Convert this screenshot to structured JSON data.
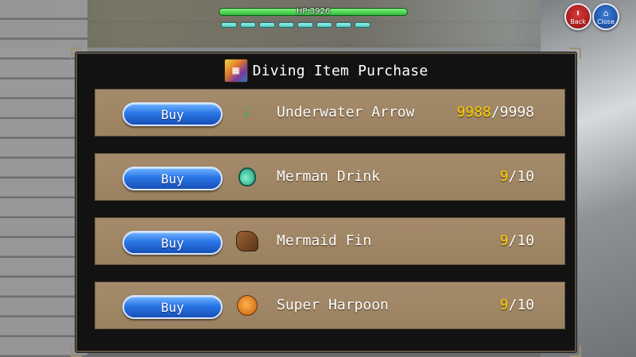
{
  "hud": {
    "hp_label": "HP:3926",
    "hp_fill": 1.0,
    "pip_count": 8,
    "back_label": "Back",
    "close_label": "Close"
  },
  "panel": {
    "title": "Diving Item Purchase",
    "items": [
      {
        "buy_label": "Buy",
        "icon": "arrow-icon",
        "name": "Underwater Arrow",
        "current": "9988",
        "max": "/9998"
      },
      {
        "buy_label": "Buy",
        "icon": "potion-bottle-icon",
        "name": "Merman Drink",
        "current": "9",
        "max": "/10"
      },
      {
        "buy_label": "Buy",
        "icon": "fin-boot-icon",
        "name": "Mermaid Fin",
        "current": "9",
        "max": "/10"
      },
      {
        "buy_label": "Buy",
        "icon": "flexed-arm-icon",
        "name": "Super Harpoon",
        "current": "9",
        "max": "/10"
      }
    ]
  },
  "colors": {
    "hp_green": "#2bbd3a",
    "pip_cyan": "#49c9c0",
    "buy_blue": "#2a76e6",
    "row_tan": "#a58b6b",
    "quantity_highlight": "#ffd200"
  }
}
